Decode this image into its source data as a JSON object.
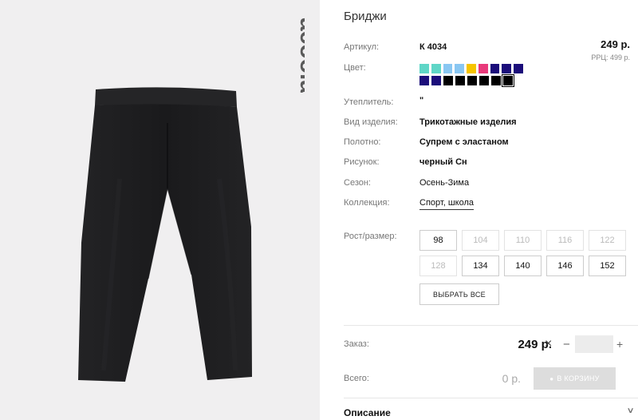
{
  "brand": {
    "logo_text": "acoola"
  },
  "product": {
    "title": "Бриджи",
    "article_label": "Артикул:",
    "article_value": "К 4034",
    "price": "249 р.",
    "rrp": "РРЦ: 499 р.",
    "color_label": "Цвет:",
    "swatches": [
      [
        "#5fd6c7",
        "#5fd6c7",
        "#89c7f2",
        "#89c7f2",
        "#f6c500",
        "#e8397a",
        "#1b0d7a",
        "#1b0d7a",
        "#1b0d7a"
      ],
      [
        "#1b0d7a",
        "#1b0d7a",
        "#000000",
        "#000000",
        "#000000",
        "#000000",
        "#000000",
        "#000000"
      ]
    ],
    "selected_swatch": "row-2-last",
    "insulation_label": "Утеплитель:",
    "insulation_value": "\"",
    "type_label": "Вид изделия:",
    "type_value": "Трикотажные изделия",
    "fabric_label": "Полотно:",
    "fabric_value": "Супрем с эластаном",
    "pattern_label": "Рисунок:",
    "pattern_value": "черный Сн",
    "season_label": "Сезон:",
    "season_value": "Осень-Зима",
    "collection_label": "Коллекция:",
    "collection_value": "Спорт, школа"
  },
  "sizes": {
    "label": "Рост/размер:",
    "row1": [
      {
        "label": "98",
        "available": true
      },
      {
        "label": "104",
        "available": false
      },
      {
        "label": "110",
        "available": false
      },
      {
        "label": "116",
        "available": false
      },
      {
        "label": "122",
        "available": false
      }
    ],
    "row2": [
      {
        "label": "128",
        "available": false
      },
      {
        "label": "134",
        "available": true
      },
      {
        "label": "140",
        "available": true
      },
      {
        "label": "146",
        "available": true
      },
      {
        "label": "152",
        "available": true
      }
    ],
    "select_all": "ВЫБРАТЬ ВСЕ"
  },
  "order": {
    "label": "Заказ:",
    "price": "249 р.",
    "times": "×",
    "minus": "−",
    "plus": "+",
    "quantity": ""
  },
  "total": {
    "label": "Всего:",
    "value": "0 р.",
    "cart_button": "В КОРЗИНУ"
  },
  "description": {
    "heading": "Описание"
  },
  "colors": {
    "image_bg": "#f0eff0",
    "garment": "#1c1c1e",
    "cart_disabled": "#dddddd"
  }
}
